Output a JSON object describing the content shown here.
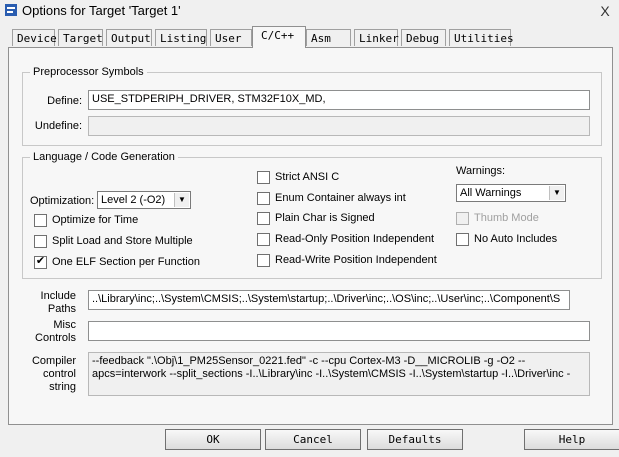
{
  "window": {
    "title": "Options for Target 'Target 1'",
    "close_glyph": "X"
  },
  "tabs": [
    {
      "label": "Device"
    },
    {
      "label": "Target"
    },
    {
      "label": "Output"
    },
    {
      "label": "Listing"
    },
    {
      "label": "User"
    },
    {
      "label": "C/C++"
    },
    {
      "label": "Asm"
    },
    {
      "label": "Linker"
    },
    {
      "label": "Debug"
    },
    {
      "label": "Utilities"
    }
  ],
  "active_tab": "C/C++",
  "preprocessor": {
    "group_title": "Preprocessor Symbols",
    "define_label": "Define:",
    "define_value": "USE_STDPERIPH_DRIVER, STM32F10X_MD,",
    "undefine_label": "Undefine:",
    "undefine_value": ""
  },
  "language": {
    "group_title": "Language / Code Generation",
    "optimization_label": "Optimization:",
    "optimization_value": "Level 2 (-O2)",
    "optimize_for_time": {
      "label": "Optimize for Time",
      "checked": false
    },
    "split_load_store": {
      "label": "Split Load and Store Multiple",
      "checked": false
    },
    "one_elf_section": {
      "label": "One ELF Section per Function",
      "checked": true
    },
    "strict_ansi_c": {
      "label": "Strict ANSI C",
      "checked": false
    },
    "enum_container": {
      "label": "Enum Container always int",
      "checked": false
    },
    "plain_char_signed": {
      "label": "Plain Char is Signed",
      "checked": false
    },
    "ro_position_independent": {
      "label": "Read-Only Position Independent",
      "checked": false
    },
    "rw_position_independent": {
      "label": "Read-Write Position Independent",
      "checked": false
    },
    "warnings_label": "Warnings:",
    "warnings_value": "All Warnings",
    "thumb_mode": {
      "label": "Thumb Mode",
      "checked": false,
      "disabled": true
    },
    "no_auto_includes": {
      "label": "No Auto Includes",
      "checked": false
    }
  },
  "paths": {
    "include_label_1": "Include",
    "include_label_2": "Paths",
    "include_value": "..\\Library\\inc;..\\System\\CMSIS;..\\System\\startup;..\\Driver\\inc;..\\OS\\inc;..\\User\\inc;..\\Component\\S",
    "browse_label": "...",
    "misc_label_1": "Misc",
    "misc_label_2": "Controls",
    "misc_value": "",
    "compiler_label_1": "Compiler",
    "compiler_label_2": "control",
    "compiler_label_3": "string",
    "compiler_line_1": "--feedback \".\\Obj\\1_PM25Sensor_0221.fed\" -c --cpu Cortex-M3 -D__MICROLIB -g -O2 --",
    "compiler_line_2": "apcs=interwork --split_sections -I..\\Library\\inc -I..\\System\\CMSIS -I..\\System\\startup -I..\\Driver\\inc -"
  },
  "buttons": {
    "ok": "OK",
    "cancel": "Cancel",
    "defaults": "Defaults",
    "help": "Help"
  },
  "icons": {
    "app": "keil-window-icon",
    "dropdown": "chevron-down-icon"
  }
}
